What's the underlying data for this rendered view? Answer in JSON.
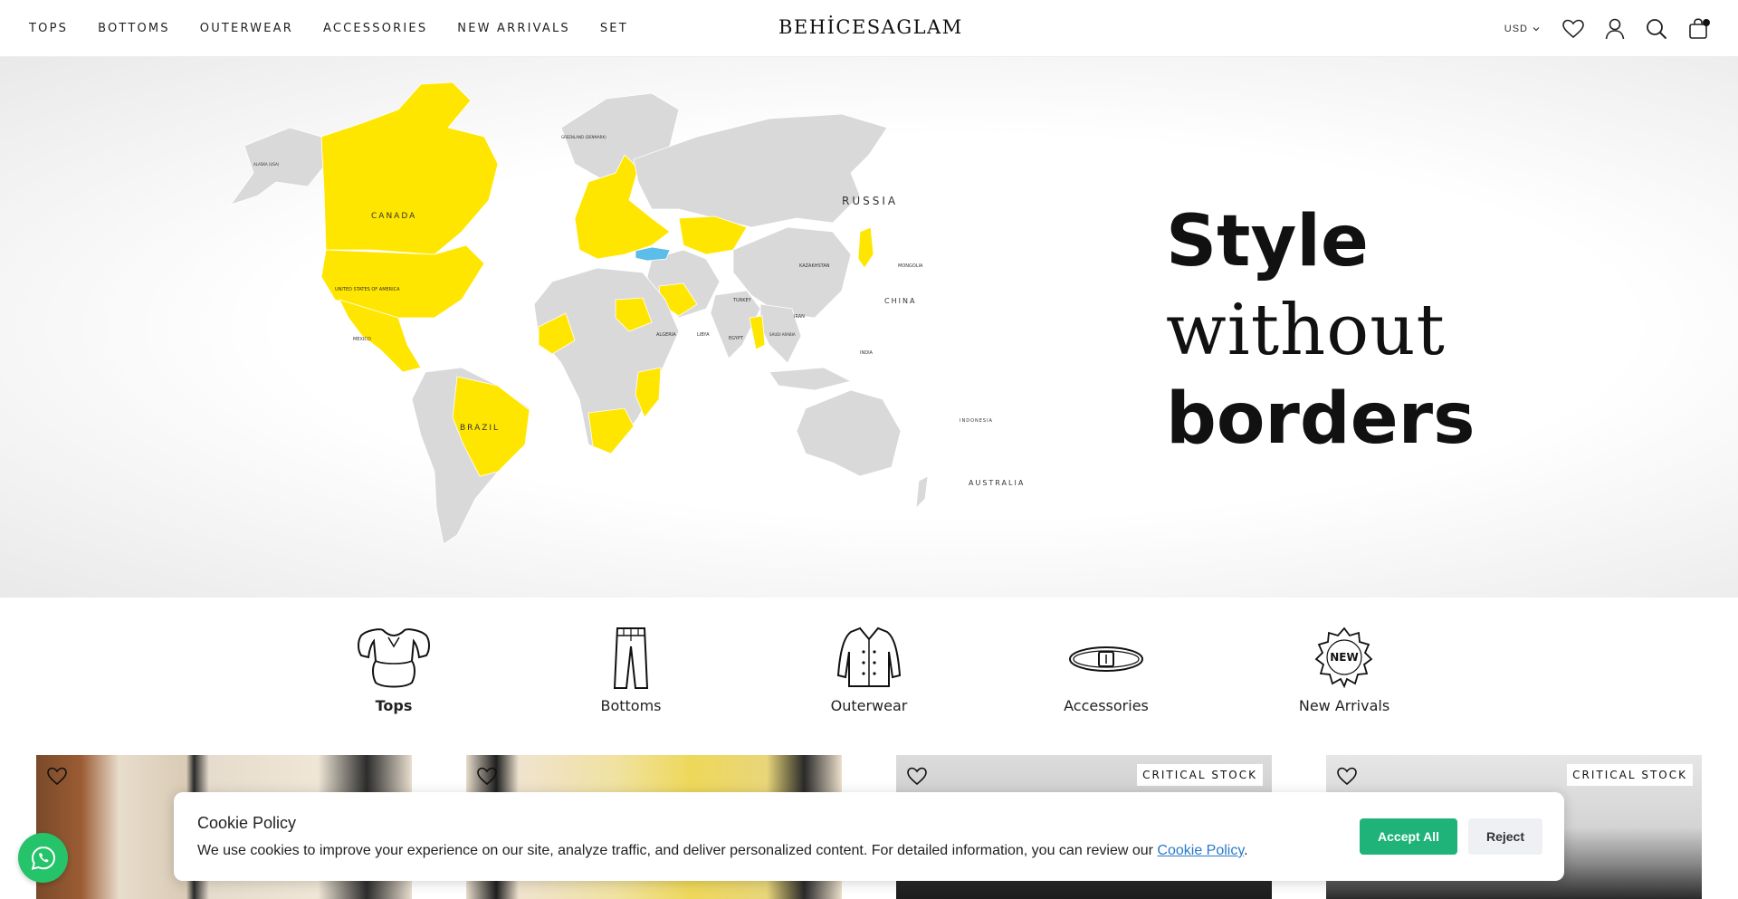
{
  "nav": {
    "items": [
      "TOPS",
      "BOTTOMS",
      "OUTERWEAR",
      "ACCESSORIES",
      "NEW ARRIVALS",
      "SET"
    ]
  },
  "logo": "BEHİCESAGLAM",
  "header": {
    "currency": "USD",
    "icons": [
      "heart-icon",
      "user-icon",
      "search-icon",
      "bag-icon"
    ]
  },
  "hero": {
    "line1": "Style",
    "line2": "without",
    "line3": "borders",
    "map_labels": {
      "canada": "CANADA",
      "usa": "UNITED STATES OF AMERICA",
      "mexico": "MEXICO",
      "brazil": "BRAZIL",
      "russia": "RUSSIA",
      "china": "CHINA",
      "kazakhstan": "KAZAKHSTAN",
      "australia": "AUSTRALIA",
      "turkey": "TURKEY",
      "greenland": "GREENLAND (DENMARK)",
      "india": "INDIA",
      "indonesia": "INDONESIA",
      "egypt": "EGYPT",
      "algeria": "ALGERIA",
      "mongolia": "MONGOLIA",
      "iran": "IRAN",
      "alaska": "ALASKA (USA)",
      "libya": "LIBYA",
      "saudi": "SAUDI ARABIA"
    },
    "colors": {
      "highlight": "#ffe600",
      "home": "#5bbde8",
      "land": "#d9d9d9"
    }
  },
  "categories": [
    {
      "label": "Tops",
      "icon": "blouse-icon",
      "active": true
    },
    {
      "label": "Bottoms",
      "icon": "trousers-icon",
      "active": false
    },
    {
      "label": "Outerwear",
      "icon": "coat-icon",
      "active": false
    },
    {
      "label": "Accessories",
      "icon": "belt-icon",
      "active": false
    },
    {
      "label": "New Arrivals",
      "icon": "new-badge-icon",
      "active": false
    }
  ],
  "products": [
    {
      "badge": ""
    },
    {
      "badge": ""
    },
    {
      "badge": "CRITICAL STOCK"
    },
    {
      "badge": "CRITICAL STOCK"
    }
  ],
  "cookie": {
    "title": "Cookie Policy",
    "text": "We use cookies to improve your experience on our site, analyze traffic, and deliver personalized content. For detailed information, you can review our",
    "link": "Cookie Policy",
    "end": ".",
    "accept": "Accept All",
    "reject": "Reject"
  }
}
